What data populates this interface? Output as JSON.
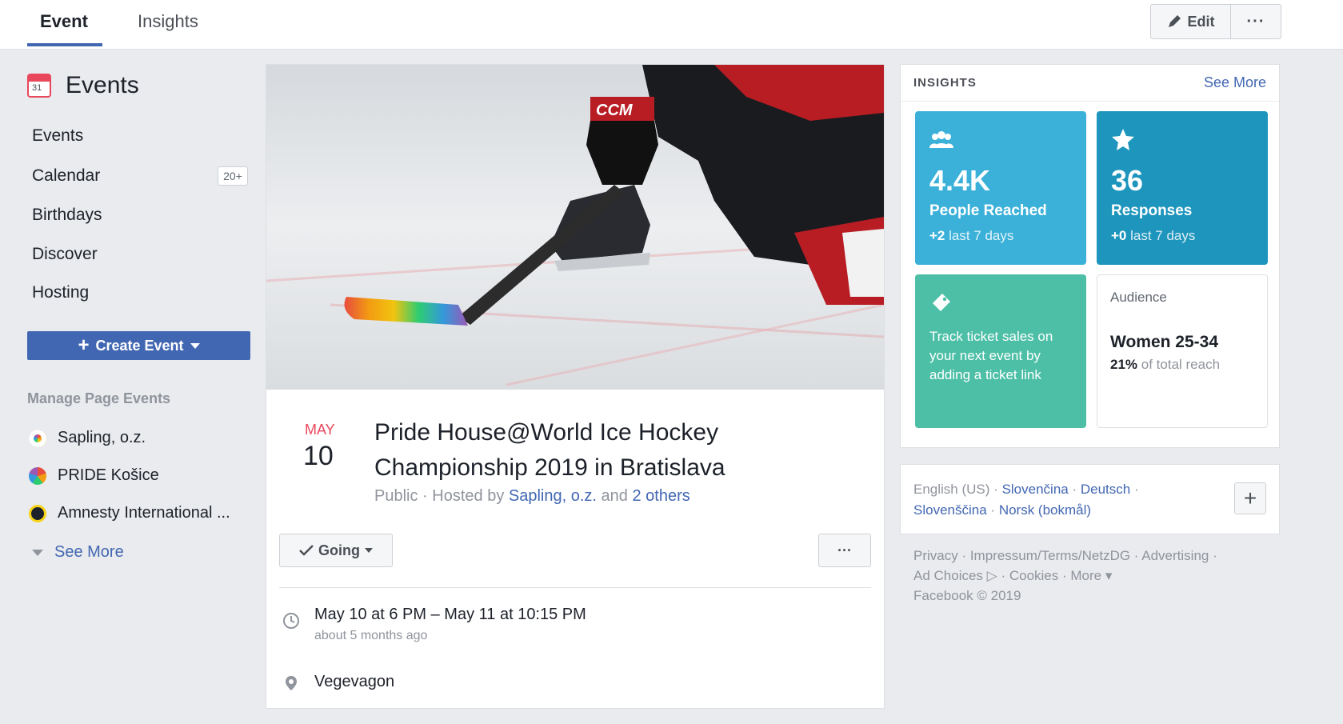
{
  "tabs": {
    "event": "Event",
    "insights": "Insights"
  },
  "topbar": {
    "edit_label": "Edit",
    "more_label": "···"
  },
  "sidebar": {
    "title": "Events",
    "cal_day": "31",
    "items": [
      {
        "label": "Events"
      },
      {
        "label": "Calendar",
        "badge": "20+"
      },
      {
        "label": "Birthdays"
      },
      {
        "label": "Discover"
      },
      {
        "label": "Hosting"
      }
    ],
    "create_label": "Create Event",
    "manage_title": "Manage Page Events",
    "pages": [
      {
        "label": "Sapling, o.z."
      },
      {
        "label": "PRIDE Košice"
      },
      {
        "label": "Amnesty International ..."
      }
    ],
    "see_more": "See More"
  },
  "event": {
    "month": "MAY",
    "day": "10",
    "title": "Pride House@World Ice Hockey Championship 2019 in Bratislava",
    "privacy": "Public",
    "hosted_prefix": "Hosted by",
    "host": "Sapling, o.z.",
    "and_text": "and",
    "others": "2 others",
    "going_label": "Going",
    "more_label": "···",
    "time": "May 10 at 6 PM – May 11 at 10:15 PM",
    "time_ago": "about 5 months ago",
    "location": "Vegevagon"
  },
  "insights": {
    "heading": "INSIGHTS",
    "see_more": "See More",
    "reach": {
      "value": "4.4K",
      "label": "People Reached",
      "delta": "+2",
      "period": "last 7 days",
      "color": "#3bb1d9"
    },
    "responses": {
      "value": "36",
      "label": "Responses",
      "delta": "+0",
      "period": "last 7 days",
      "color": "#1d95bd"
    },
    "tickets": {
      "text": "Track ticket sales on your next event by adding a ticket link",
      "color": "#4cbfa6"
    },
    "audience": {
      "label": "Audience",
      "value": "Women 25-34",
      "pct": "21%",
      "pct_suffix": "of total reach"
    }
  },
  "languages": {
    "current": "English (US)",
    "l1": "Slovenčina",
    "l2": "Deutsch",
    "l3": "Slovenščina",
    "l4": "Norsk (bokmål)",
    "sep": "·"
  },
  "footer": {
    "line1": "Privacy · Impressum/Terms/NetzDG · Advertising ·",
    "line2": "Ad Choices ▷ · Cookies · More ▾",
    "line3": "Facebook © 2019"
  }
}
